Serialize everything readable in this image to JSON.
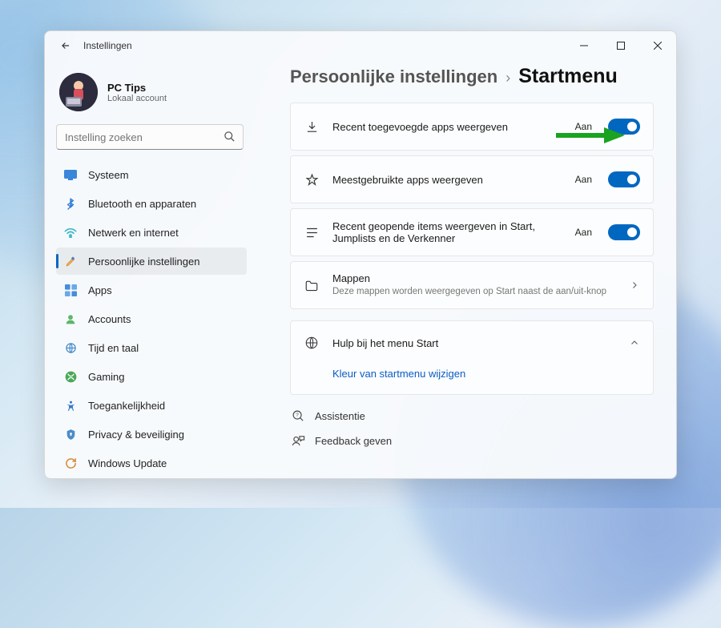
{
  "window": {
    "title": "Instellingen"
  },
  "user": {
    "name": "PC Tips",
    "subtitle": "Lokaal account"
  },
  "search": {
    "placeholder": "Instelling zoeken"
  },
  "sidebar": {
    "items": [
      {
        "label": "Systeem"
      },
      {
        "label": "Bluetooth en apparaten"
      },
      {
        "label": "Netwerk en internet"
      },
      {
        "label": "Persoonlijke instellingen"
      },
      {
        "label": "Apps"
      },
      {
        "label": "Accounts"
      },
      {
        "label": "Tijd en taal"
      },
      {
        "label": "Gaming"
      },
      {
        "label": "Toegankelijkheid"
      },
      {
        "label": "Privacy & beveiliging"
      },
      {
        "label": "Windows Update"
      }
    ]
  },
  "breadcrumb": {
    "parent": "Persoonlijke instellingen",
    "separator": "›",
    "current": "Startmenu"
  },
  "settings": [
    {
      "title": "Recent toegevoegde apps weergeven",
      "state": "Aan"
    },
    {
      "title": "Meestgebruikte apps weergeven",
      "state": "Aan"
    },
    {
      "title": "Recent geopende items weergeven in Start, Jumplists en de Verkenner",
      "state": "Aan"
    },
    {
      "title": "Mappen",
      "sub": "Deze mappen worden weergegeven op Start naast de aan/uit-knop"
    }
  ],
  "help": {
    "title": "Hulp bij het menu Start",
    "link": "Kleur van startmenu wijzigen"
  },
  "footer": {
    "assist": "Assistentie",
    "feedback": "Feedback geven"
  },
  "colors": {
    "accent": "#0067c0",
    "arrow": "#1aa321"
  }
}
